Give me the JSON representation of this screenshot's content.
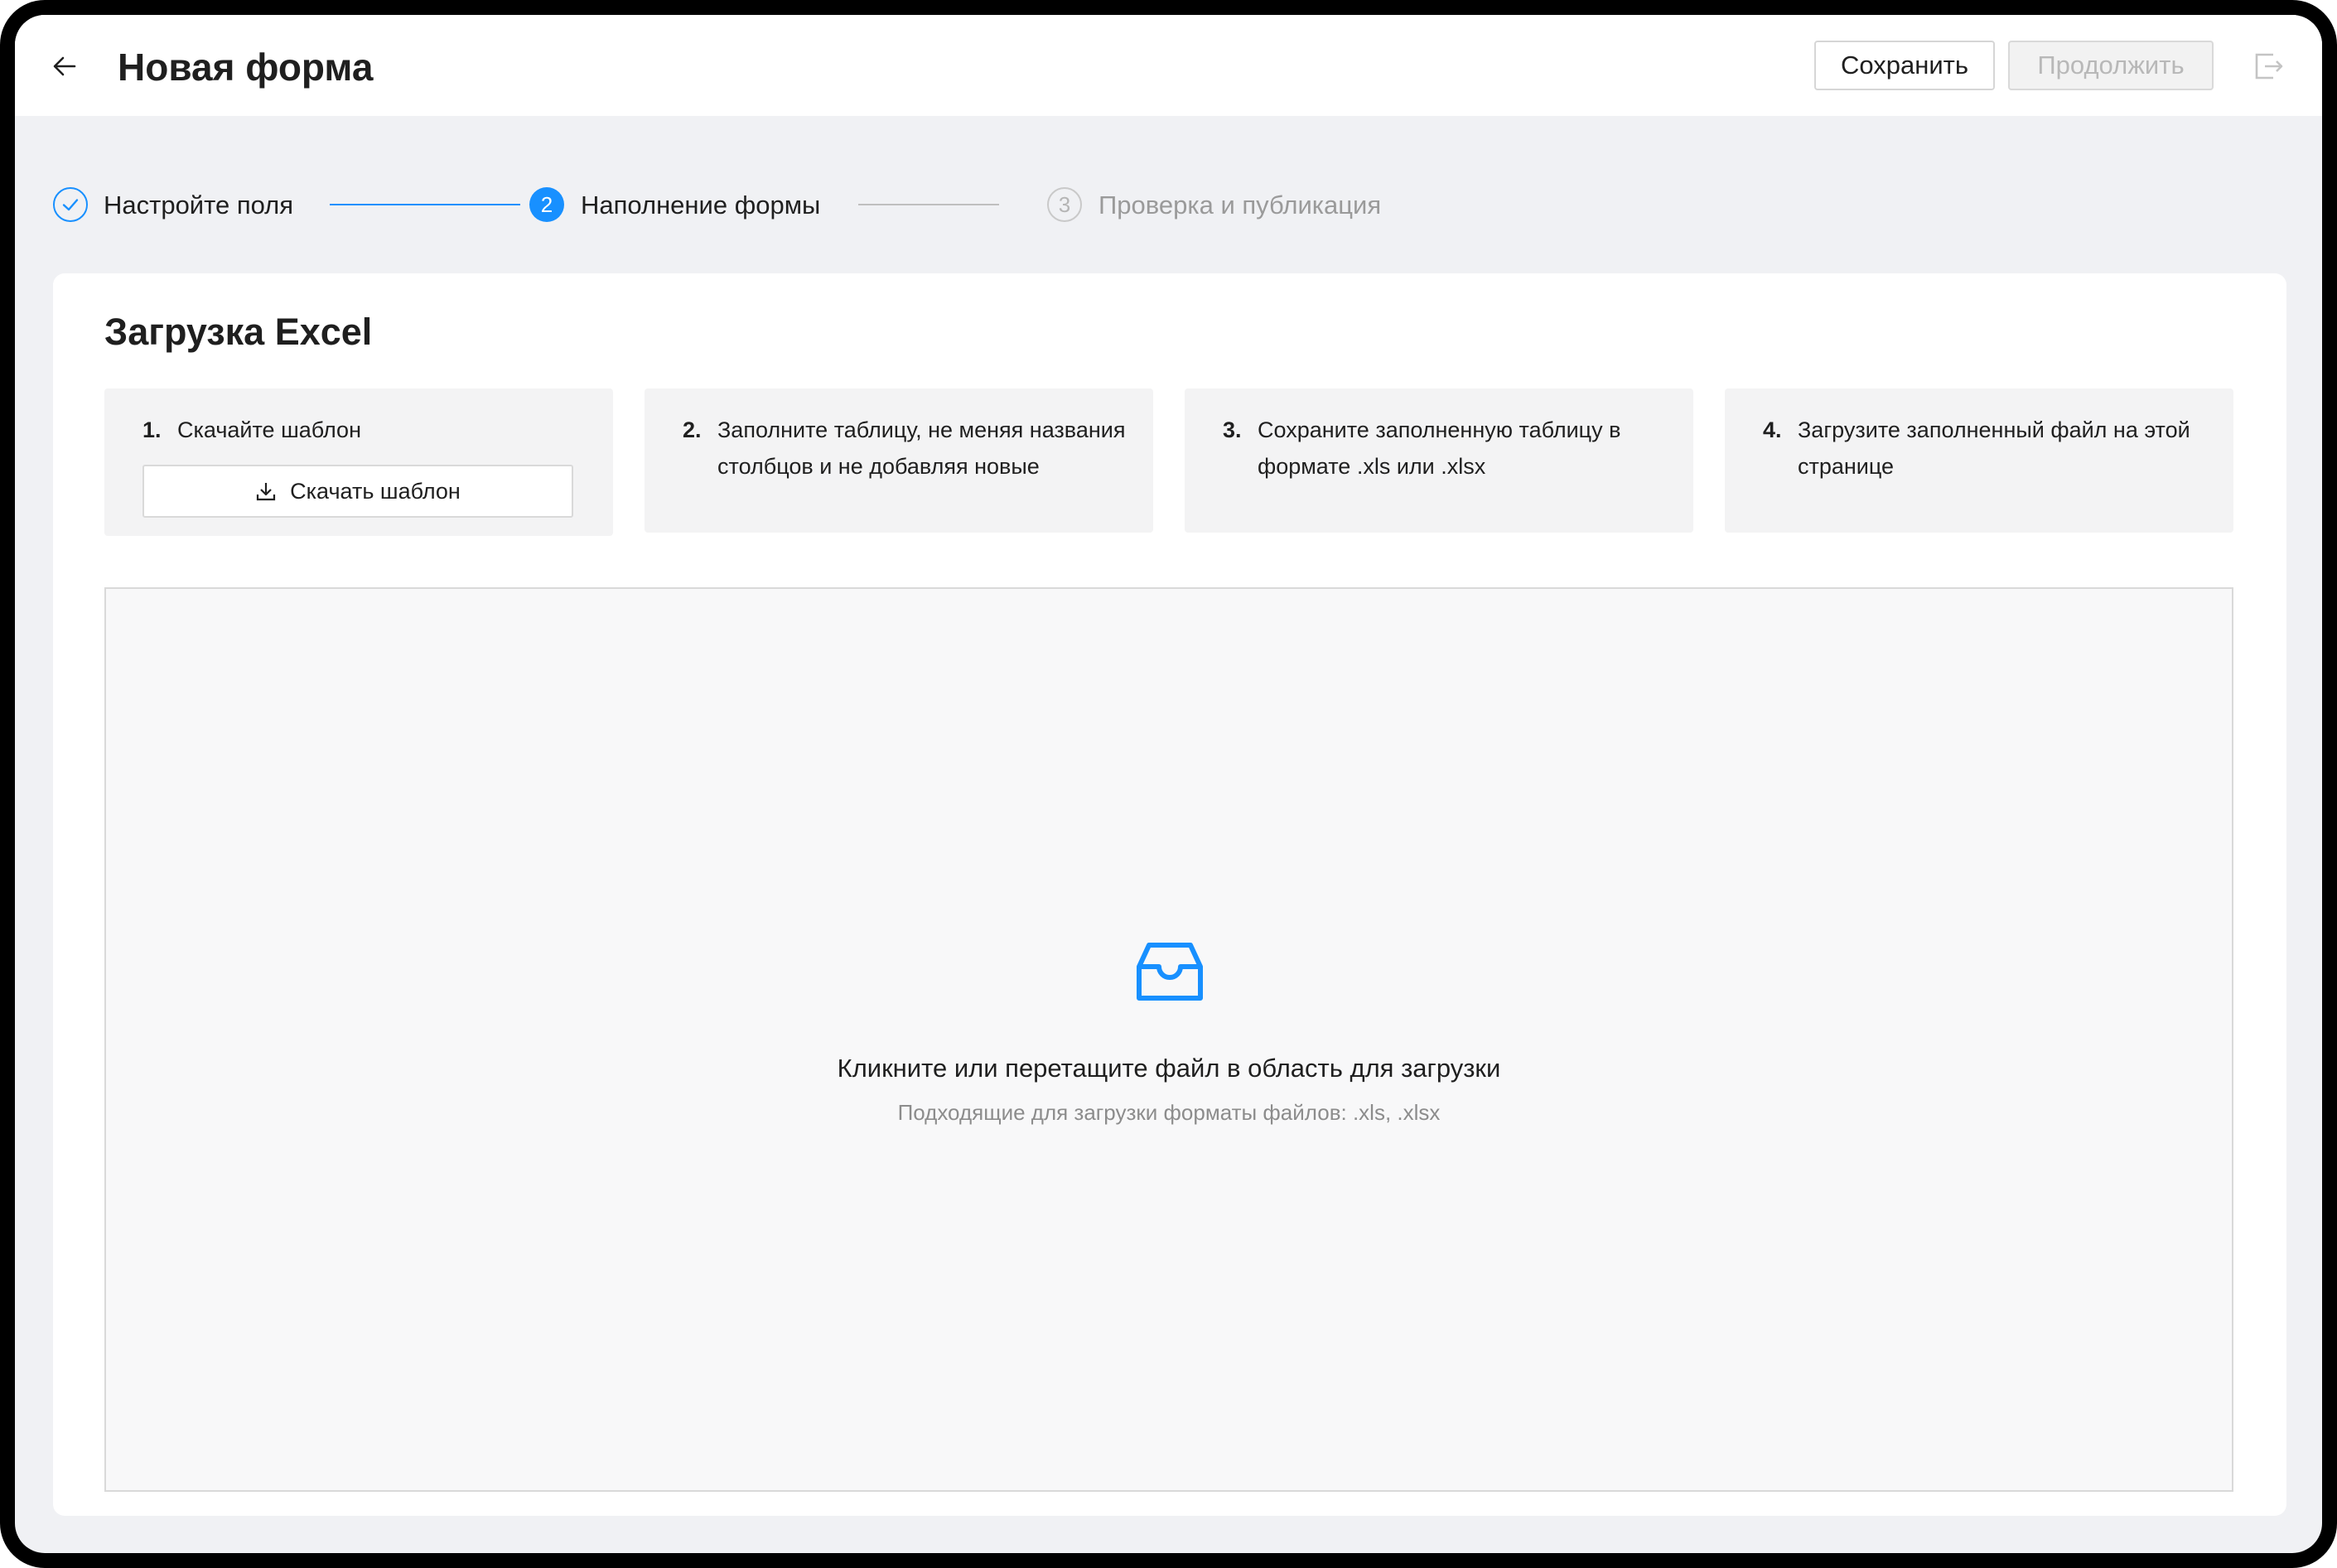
{
  "header": {
    "title": "Новая форма",
    "back_icon": "arrow-left-icon",
    "save_label": "Сохранить",
    "continue_label": "Продолжить",
    "exit_icon": "exit-icon"
  },
  "stepper": {
    "steps": [
      {
        "index": "1",
        "label": "Настройте поля",
        "status": "done"
      },
      {
        "index": "2",
        "label": "Наполнение формы",
        "status": "active"
      },
      {
        "index": "3",
        "label": "Проверка и публикация",
        "status": "wait"
      }
    ],
    "accent_color": "#1890ff"
  },
  "upload": {
    "title": "Загрузка Excel",
    "instructions": [
      {
        "num": "1.",
        "text": "Скачайте шаблон"
      },
      {
        "num": "2.",
        "text": "Заполните таблицу, не меняя названия столбцов и не добавляя новые"
      },
      {
        "num": "3.",
        "text": "Сохраните заполненную таблицу в формате .xls или .xlsx"
      },
      {
        "num": "4.",
        "text": "Загрузите заполненный файл на этой странице"
      }
    ],
    "download_button": {
      "label": "Скачать шаблон",
      "icon": "download-icon"
    },
    "dropzone": {
      "icon": "inbox-icon",
      "text": "Кликните или перетащите файл в область для загрузки",
      "hint": "Подходящие для загрузки форматы файлов: .xls, .xlsx"
    }
  }
}
